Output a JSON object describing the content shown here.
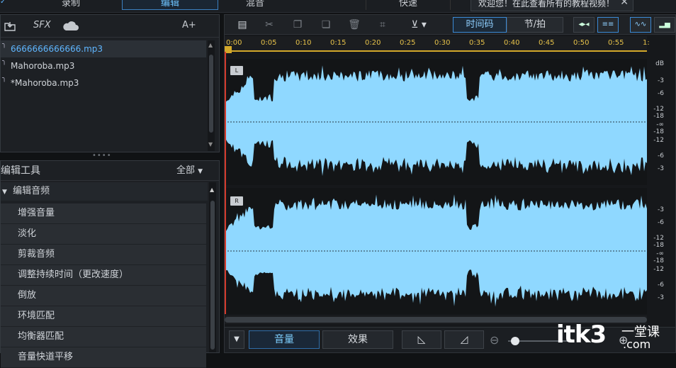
{
  "top_tabs": [
    "录制",
    "编辑",
    "混音",
    "快速"
  ],
  "notice": {
    "text": "欢迎您！在此查看所有的教程视频！",
    "close": "✕"
  },
  "left_toolbar": {
    "sfx": "SFX",
    "font": "A+"
  },
  "files": [
    {
      "name": "6666666666666.mp3",
      "selected": true
    },
    {
      "name": "Mahoroba.mp3",
      "selected": false
    },
    {
      "name": "*Mahoroba.mp3",
      "selected": false
    }
  ],
  "tools": {
    "title": "编辑工具",
    "filter": "全部",
    "section": "编辑音频",
    "items": [
      "增强音量",
      "淡化",
      "剪裁音频",
      "调整持续时间（更改速度）",
      "倒放",
      "环境匹配",
      "均衡器匹配",
      "音量快道平移"
    ]
  },
  "editor": {
    "mode_timecode": "时间码",
    "mode_beat": "节/拍",
    "ruler_ticks": [
      "0:00",
      "0:05",
      "0:10",
      "0:15",
      "0:20",
      "0:25",
      "0:30",
      "0:35",
      "0:40",
      "0:45",
      "0:50",
      "0:55",
      "1:"
    ],
    "channels": [
      {
        "label": "L"
      },
      {
        "label": "R"
      }
    ],
    "db_unit": "dB",
    "db_ticks_top": [
      "-3",
      "-6",
      "-12",
      "-18",
      "-∞",
      "-18",
      "-12",
      "-6",
      "-3"
    ],
    "db_ticks_bottom": [
      "-3",
      "-6",
      "-12",
      "-18",
      "-∞",
      "-18",
      "-12",
      "-6",
      "-3"
    ],
    "bottom_buttons": {
      "volume": "音量",
      "effects": "效果"
    }
  },
  "watermark": {
    "brand": "itk3",
    "sub": "一堂课",
    "domain": ".com"
  },
  "colors": {
    "accent": "#5fb6ff",
    "waveform": "#8fd8ff",
    "ruler": "#e6c24a",
    "playhead": "#d33a2c"
  }
}
